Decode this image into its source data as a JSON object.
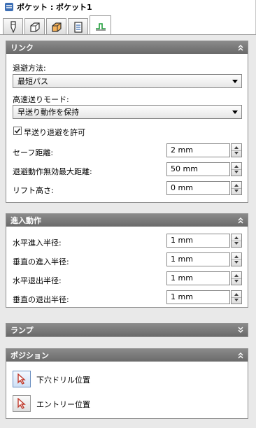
{
  "window": {
    "title": "ポケット : ポケット1"
  },
  "tabs": [
    {
      "icon": "tool-icon"
    },
    {
      "icon": "shape-icon"
    },
    {
      "icon": "box-icon"
    },
    {
      "icon": "sheet-icon"
    },
    {
      "icon": "link-icon",
      "active": true
    }
  ],
  "link": {
    "header": "リンク",
    "retract_method_label": "退避方法:",
    "retract_method_value": "最短パス",
    "rapid_mode_label": "高速送りモード:",
    "rapid_mode_value": "早送り動作を保持",
    "allow_rapid_label": "早送り退避を許可",
    "allow_rapid_checked": true,
    "safe_distance_label": "セーフ距離:",
    "safe_distance_value": "2 mm",
    "max_disable_label": "退避動作無効最大距離:",
    "max_disable_value": "50 mm",
    "lift_height_label": "リフト高さ:",
    "lift_height_value": "0 mm"
  },
  "approach": {
    "header": "進入動作",
    "h_approach_label": "水平進入半径:",
    "h_approach_value": "1 mm",
    "v_approach_label": "垂直の進入半径:",
    "v_approach_value": "1 mm",
    "h_exit_label": "水平退出半径:",
    "h_exit_value": "1 mm",
    "v_exit_label": "垂直の退出半径:",
    "v_exit_value": "1 mm"
  },
  "ramp": {
    "header": "ランプ"
  },
  "position": {
    "header": "ポジション",
    "pilot_drill_label": "下穴ドリル位置",
    "entry_label": "エントリー位置"
  },
  "colors": {
    "group_header": "#7a7a7a",
    "panel_bg": "#e9e9e9",
    "pick_accent": "#c0392b"
  }
}
